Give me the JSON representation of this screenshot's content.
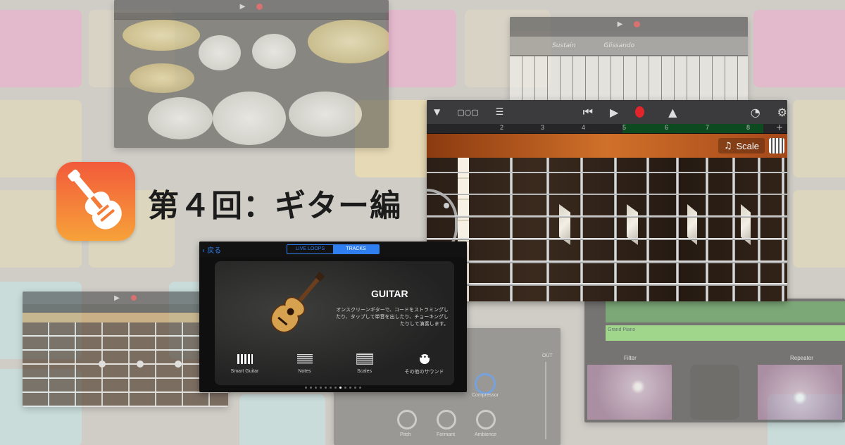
{
  "title": "第４回：ギター編",
  "app_icon": {
    "name": "garageband-guitar-icon",
    "gradient_top": "#f25a3a",
    "gradient_bottom": "#f7a23a"
  },
  "colors": {
    "accent_blue": "#2f7ff0",
    "record_red": "#e0262b",
    "background": "#cfcdc6"
  },
  "guitar_main": {
    "ruler_numbers": [
      "2",
      "3",
      "4",
      "5",
      "6",
      "7",
      "8"
    ],
    "scale_button": "Scale"
  },
  "keyboard_screen": {
    "sustain_label": "Sustain",
    "glissando_label": "Glissando"
  },
  "browser": {
    "back_label": "戻る",
    "segment_live_loops": "LIVE LOOPS",
    "segment_tracks": "TRACKS",
    "instrument_title": "GUITAR",
    "description": "オンスクリーンギターで、コードをストラミングしたり、タップして単音を出したり、チョーキングしたりして演奏します。",
    "options": [
      {
        "label": "Smart Guitar",
        "icon": "smart-guitar-icon"
      },
      {
        "label": "Notes",
        "icon": "notes-fretboard-icon"
      },
      {
        "label": "Scales",
        "icon": "scales-fretboard-icon"
      },
      {
        "label": "その他のサウンド",
        "icon": "more-sounds-icon"
      }
    ],
    "page_dots": 12,
    "active_dot": 7
  },
  "fx_screen": {
    "track_name": "Grand Piano",
    "filter_label": "Filter",
    "repeater_label": "Repeater"
  },
  "knob_screen": {
    "knobs": [
      "Compressor",
      "Pitch",
      "Formant",
      "Ambience"
    ],
    "out_label": "OUT"
  }
}
